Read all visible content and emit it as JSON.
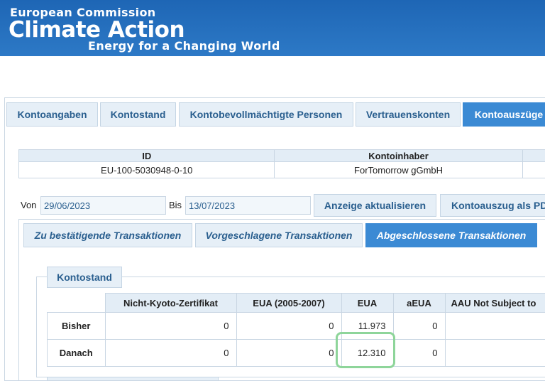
{
  "header": {
    "org": "European Commission",
    "title": "Climate Action",
    "tagline": "Energy for a Changing World",
    "bg_color": "#1e66b5"
  },
  "tabs": [
    "Kontoangaben",
    "Kontostand",
    "Kontobevollmächtigte Personen",
    "Vertrauenskonten",
    "Kontoauszüge"
  ],
  "active_tab": "Kontoauszüge",
  "account": {
    "id_header": "ID",
    "holder_header": "Kontoinhaber",
    "id_value": "EU-100-5030948-0-10",
    "holder_value": "ForTomorrow gGmbH"
  },
  "filter": {
    "from_label": "Von",
    "from_value": "29/06/2023",
    "to_label": "Bis",
    "to_value": "13/07/2023",
    "refresh_button": "Anzeige aktualisieren",
    "pdf_button": "Kontoauszug als PDF"
  },
  "subtabs": [
    "Zu bestätigende Transaktionen",
    "Vorgeschlagene Transaktionen",
    "Abgeschlossene Transaktionen"
  ],
  "active_subtab": "Abgeschlossene Transaktionen",
  "balance": {
    "legend": "Kontostand",
    "columns": [
      "Nicht-Kyoto-Zertifikat",
      "EUA (2005-2007)",
      "EUA",
      "aEUA",
      "AAU Not Subject to"
    ],
    "rows": [
      {
        "label": "Bisher",
        "values": [
          "0",
          "0",
          "11.973",
          "0",
          ""
        ]
      },
      {
        "label": "Danach",
        "values": [
          "0",
          "0",
          "12.310",
          "0",
          ""
        ]
      }
    ]
  },
  "colors": {
    "accent": "#3b8ad4",
    "tab_bg": "#e6eff7",
    "tab_text": "#2a5f8f",
    "highlight": "#8ed59a"
  }
}
